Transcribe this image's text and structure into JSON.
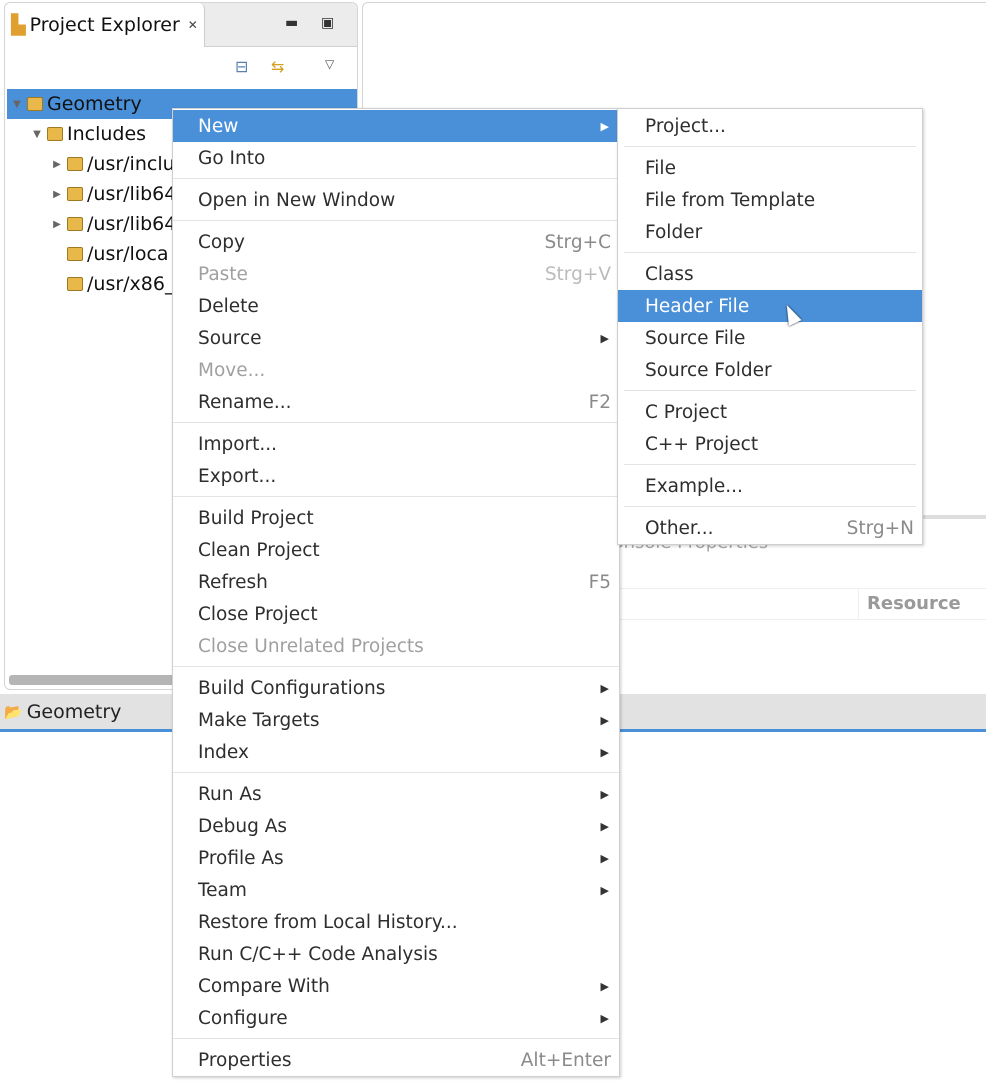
{
  "project_explorer": {
    "tab_title": "Project Explorer",
    "tree": [
      {
        "label": "Geometry",
        "level": 0,
        "expanded": true,
        "selected": true
      },
      {
        "label": "Includes",
        "level": 1,
        "expanded": true
      },
      {
        "label": "/usr/inclu",
        "level": 2,
        "collapsed": true
      },
      {
        "label": "/usr/lib64",
        "level": 2,
        "collapsed": true
      },
      {
        "label": "/usr/lib64",
        "level": 2,
        "collapsed": true
      },
      {
        "label": "/usr/loca",
        "level": 2
      },
      {
        "label": "/usr/x86_",
        "level": 2
      }
    ]
  },
  "status_bar": {
    "label": "Geometry"
  },
  "lower_panel": {
    "tabs_text": "Console Properties",
    "column_resource": "Resource"
  },
  "context_menu": [
    {
      "label": "New",
      "submenu": true,
      "highlighted": true
    },
    {
      "label": "Go Into"
    },
    {
      "sep": true
    },
    {
      "label": "Open in New Window"
    },
    {
      "sep": true
    },
    {
      "label": "Copy",
      "accel": "Strg+C"
    },
    {
      "label": "Paste",
      "accel": "Strg+V",
      "disabled": true
    },
    {
      "label": "Delete"
    },
    {
      "label": "Source",
      "submenu": true
    },
    {
      "label": "Move...",
      "disabled": true
    },
    {
      "label": "Rename...",
      "accel": "F2"
    },
    {
      "sep": true
    },
    {
      "label": "Import..."
    },
    {
      "label": "Export..."
    },
    {
      "sep": true
    },
    {
      "label": "Build Project"
    },
    {
      "label": "Clean Project"
    },
    {
      "label": "Refresh",
      "accel": "F5"
    },
    {
      "label": "Close Project"
    },
    {
      "label": "Close Unrelated Projects",
      "disabled": true
    },
    {
      "sep": true
    },
    {
      "label": "Build Configurations",
      "submenu": true
    },
    {
      "label": "Make Targets",
      "submenu": true
    },
    {
      "label": "Index",
      "submenu": true
    },
    {
      "sep": true
    },
    {
      "label": "Run As",
      "submenu": true
    },
    {
      "label": "Debug As",
      "submenu": true
    },
    {
      "label": "Profile As",
      "submenu": true
    },
    {
      "label": "Team",
      "submenu": true
    },
    {
      "label": "Restore from Local History..."
    },
    {
      "label": "Run C/C++ Code Analysis"
    },
    {
      "label": "Compare With",
      "submenu": true
    },
    {
      "label": "Configure",
      "submenu": true
    },
    {
      "sep": true
    },
    {
      "label": "Properties",
      "accel": "Alt+Enter"
    }
  ],
  "new_submenu": [
    {
      "label": "Project..."
    },
    {
      "sep": true
    },
    {
      "label": "File"
    },
    {
      "label": "File from Template"
    },
    {
      "label": "Folder"
    },
    {
      "sep": true
    },
    {
      "label": "Class"
    },
    {
      "label": "Header File",
      "highlighted": true
    },
    {
      "label": "Source File"
    },
    {
      "label": "Source Folder"
    },
    {
      "sep": true
    },
    {
      "label": "C Project"
    },
    {
      "label": "C++ Project"
    },
    {
      "sep": true
    },
    {
      "label": "Example..."
    },
    {
      "sep": true
    },
    {
      "label": "Other...",
      "accel": "Strg+N"
    }
  ],
  "colors": {
    "selection": "#4a90d9"
  }
}
